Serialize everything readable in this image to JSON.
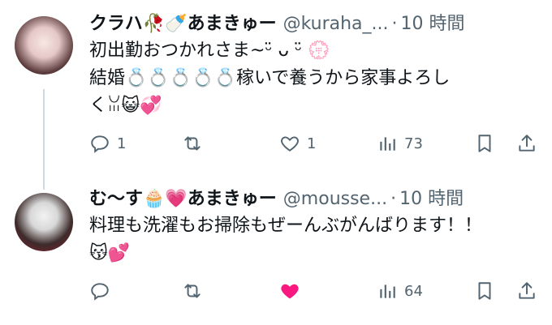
{
  "colors": {
    "text": "#0f1419",
    "muted": "#536471",
    "like_active": "#f91880",
    "line": "#cfd9de"
  },
  "tweets": [
    {
      "display_name": "クラハ🥀🍼あまきゅー",
      "handle": "@kuraha_...",
      "separator": "·",
      "time": "10 時間",
      "text": "初出勤おつかれさま~ᵕ̈ ᴗ ᵕ̈ 💮\n結婚💍💍💍💍💍稼いで養うから家事よろし\nくꈍ😺💞",
      "actions": {
        "reply": "1",
        "retweet": "",
        "like": "1",
        "views": "73"
      },
      "like_active": false
    },
    {
      "display_name": "む〜す🧁💗あまきゅー",
      "handle": "@mousse...",
      "separator": "·",
      "time": "10 時間",
      "text": "料理も洗濯もお掃除もぜーんぶがんばります！！\n😽💕",
      "actions": {
        "reply": "",
        "retweet": "",
        "like": "",
        "views": "64"
      },
      "like_active": true
    }
  ]
}
